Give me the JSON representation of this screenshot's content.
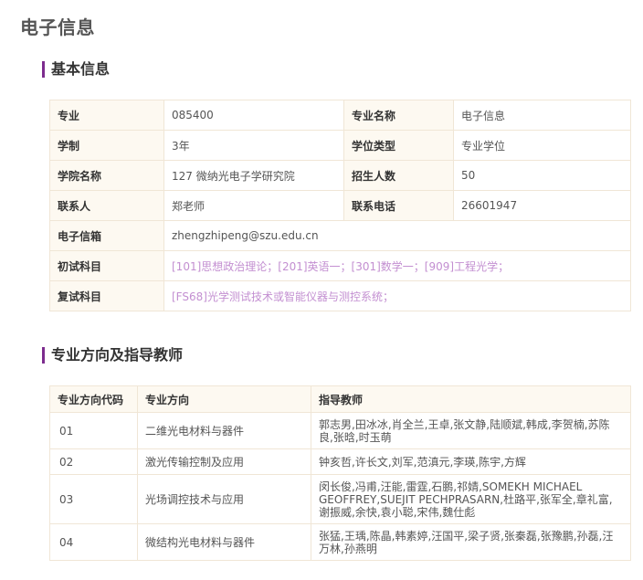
{
  "page": {
    "title": "电子信息"
  },
  "colors": {
    "accent": "#7d2c8e",
    "link": "#c38fd1",
    "label_bg": "#fdf9f1",
    "border": "#f0e6d6"
  },
  "basic_info": {
    "section_title": "基本信息",
    "major_label": "专业",
    "major_value": "085400",
    "major_name_label": "专业名称",
    "major_name_value": "电子信息",
    "duration_label": "学制",
    "duration_value": "3年",
    "degree_type_label": "学位类型",
    "degree_type_value": "专业学位",
    "college_label": "学院名称",
    "college_value": "127 微纳光电子学研究院",
    "enrollment_label": "招生人数",
    "enrollment_value": "50",
    "contact_label": "联系人",
    "contact_value": "郑老师",
    "phone_label": "联系电话",
    "phone_value": "26601947",
    "email_label": "电子信箱",
    "email_value": "zhengzhipeng@szu.edu.cn",
    "initial_exam_label": "初试科目",
    "initial_exam_value": "[101]思想政治理论；[201]英语一；[301]数学一；[909]工程光学；",
    "retest_label": "复试科目",
    "retest_value": "[FS68]光学测试技术或智能仪器与测控系统；"
  },
  "directions": {
    "section_title": "专业方向及指导教师",
    "headers": [
      "专业方向代码",
      "专业方向",
      "指导教师"
    ],
    "rows": [
      {
        "code": "01",
        "name": "二维光电材料与器件",
        "advisors": "郭志男,田冰冰,肖全兰,王卓,张文静,陆顺斌,韩成,李贺楠,苏陈良,张晗,时玉萌"
      },
      {
        "code": "02",
        "name": "激光传输控制及应用",
        "advisors": "钟亥哲,许长文,刘军,范滇元,李瑛,陈宇,方辉"
      },
      {
        "code": "03",
        "name": "光场调控技术与应用",
        "advisors": "闵长俊,冯甫,汪能,雷霆,石鹏,祁婧,SOMEKH MICHAEL GEOFFREY,SUEJIT PECHPRASARN,杜路平,张军全,章礼富,谢振威,余快,袁小聪,宋伟,魏仕彪"
      },
      {
        "code": "04",
        "name": "微结构光电材料与器件",
        "advisors": "张猛,王瑀,陈晶,韩素婷,汪国平,梁子贤,张秦磊,张豫鹏,孙磊,汪万林,孙燕明"
      }
    ]
  }
}
